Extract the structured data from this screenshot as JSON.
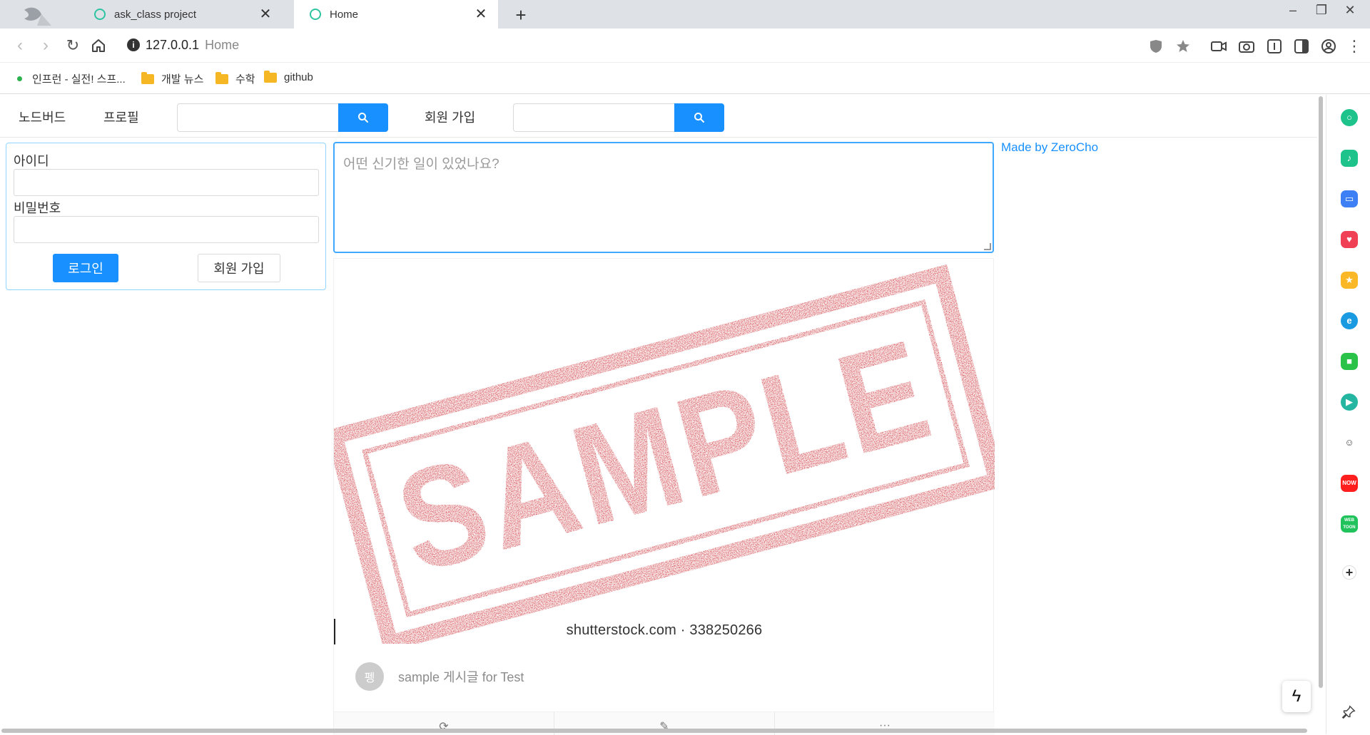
{
  "browser": {
    "tabs": [
      {
        "title": "ask_class project",
        "active": false
      },
      {
        "title": "Home",
        "active": true
      }
    ],
    "new_tab": "+",
    "window_controls": {
      "minimize": "–",
      "restore": "❐",
      "close": "✕"
    },
    "url": {
      "host": "127.0.0.1",
      "page_title": "Home"
    },
    "bookmarks": [
      {
        "label": "인프런 - 실전! 스프...",
        "type": "site"
      },
      {
        "label": "개발 뉴스",
        "type": "folder"
      },
      {
        "label": "수학",
        "type": "folder"
      },
      {
        "label": "github",
        "type": "folder"
      }
    ],
    "accent_color": "#1890ff"
  },
  "menu": {
    "home": "노드버드",
    "profile": "프로필",
    "signup": "회원 가입",
    "search1_placeholder": "",
    "search2_placeholder": ""
  },
  "login": {
    "id_label": "아이디",
    "password_label": "비밀번호",
    "login_button": "로그인",
    "signup_button": "회원 가입"
  },
  "post_form": {
    "placeholder": "어떤 신기한 일이 있었나요?"
  },
  "post": {
    "image_text": "SAMPLE",
    "image_caption": "shutterstock.com · 338250266",
    "author_initial": "펭",
    "content": "sample 게시글 for Test",
    "actions": [
      "retweet-icon",
      "edit-icon",
      "ellipsis-icon"
    ]
  },
  "footer_credit": "Made by ZeroCho",
  "side_panel": {
    "icons": [
      {
        "name": "ring-app-icon",
        "color": "#1ec38b"
      },
      {
        "name": "bell-app-icon",
        "color": "#1ec38b"
      },
      {
        "name": "briefcase-app-icon",
        "color": "#3d7ff4"
      },
      {
        "name": "pocket-app-icon",
        "color": "#ef4056"
      },
      {
        "name": "star-app-icon",
        "color": "#fbb826"
      },
      {
        "name": "edge-app-icon",
        "color": "#1a9ae0"
      },
      {
        "name": "notes-app-icon",
        "color": "#2bc24a"
      },
      {
        "name": "play-app-icon",
        "color": "#24b6a0"
      },
      {
        "name": "cartoon-app-icon",
        "color": "#555555"
      },
      {
        "name": "now-app-icon",
        "color": "#ff1e1e",
        "label": "NOW"
      },
      {
        "name": "webtoon-app-icon",
        "color": "#1fc25b",
        "label": "WEB TOON"
      }
    ],
    "add": "+"
  }
}
